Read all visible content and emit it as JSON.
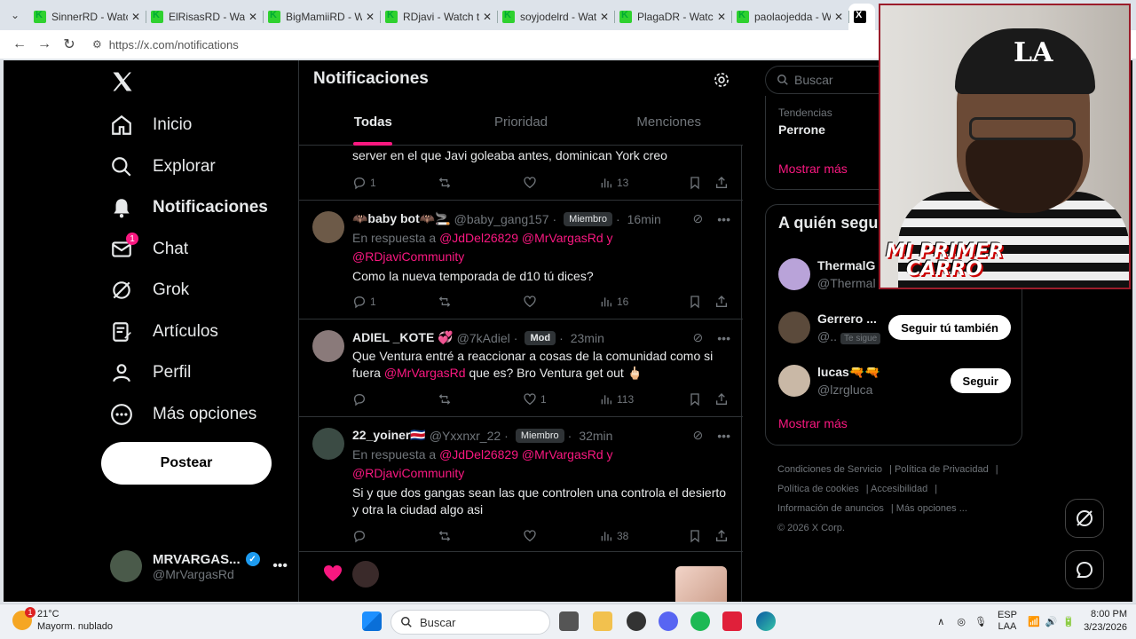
{
  "browser": {
    "tabs": [
      {
        "title": "SinnerRD - Watch t"
      },
      {
        "title": "ElRisasRD - Watch t"
      },
      {
        "title": "BigMamiiRD - Watc"
      },
      {
        "title": "RDjavi - Watch the"
      },
      {
        "title": "soyjodelrd - Watch"
      },
      {
        "title": "PlagaDR - Watch th"
      },
      {
        "title": "paolaojedda - Watc"
      }
    ],
    "url": "https://x.com/notifications"
  },
  "sidebar": {
    "items": [
      {
        "label": "Inicio"
      },
      {
        "label": "Explorar"
      },
      {
        "label": "Notificaciones"
      },
      {
        "label": "Chat",
        "badge": "1"
      },
      {
        "label": "Grok"
      },
      {
        "label": "Artículos"
      },
      {
        "label": "Perfil"
      },
      {
        "label": "Más opciones"
      }
    ],
    "post_label": "Postear",
    "profile": {
      "name": "MRVARGAS...",
      "handle": "@MrVargasRd"
    }
  },
  "main": {
    "title": "Notificaciones",
    "tabs": [
      {
        "label": "Todas"
      },
      {
        "label": "Prioridad"
      },
      {
        "label": "Menciones"
      }
    ],
    "posts": [
      {
        "body": "server en el que Javi goleaba antes, dominican York creo",
        "replies": "1",
        "likes": "",
        "views": "13"
      },
      {
        "name": "🦇baby bot🦇🚬",
        "handle": "@baby_gang157",
        "tag": "Miembro",
        "time": "16min",
        "reply_prefix": "En respuesta a ",
        "reply_mentions": "@JdDel26829 @MrVargasRd y @RDjaviCommunity",
        "body": "Como la nueva temporada de d10 tú dices?",
        "replies": "1",
        "likes": "",
        "views": "16"
      },
      {
        "name": "ADIEL _KOTE 💞",
        "handle": "@7kAdiel",
        "tag": "Mod",
        "time": "23min",
        "body_pre": "Que Ventura entré a reaccionar a cosas de la comunidad como si fuera ",
        "body_mention": "@MrVargasRd",
        "body_post": " que es? Bro Ventura get out 🖕🏻",
        "replies": "",
        "likes": "1",
        "views": "113"
      },
      {
        "name": "22_yoiner🇨🇷",
        "handle": "@Yxxnxr_22",
        "tag": "Miembro",
        "time": "32min",
        "reply_prefix": "En respuesta a ",
        "reply_mentions": "@JdDel26829 @MrVargasRd y @RDjaviCommunity",
        "body": "Si y que dos gangas sean las que controlen una controla el desierto y otra la ciudad algo asi",
        "replies": "",
        "likes": "",
        "views": "38"
      }
    ]
  },
  "right": {
    "search_placeholder": "Buscar",
    "trends": {
      "subtitle": "Tendencias",
      "title": "Perrone",
      "more": "Mostrar más"
    },
    "who": {
      "title": "A quién segu",
      "rows": [
        {
          "name": "ThermalG",
          "handle": "@Thermal",
          "button": ""
        },
        {
          "name": "Gerrero ...",
          "handle": "@..",
          "follows_you": "Te sigue",
          "button": "Seguir tú también"
        },
        {
          "name": "lucas🔫🔫",
          "handle": "@lzrgluca",
          "button": "Seguir"
        }
      ],
      "more": "Mostrar más"
    },
    "footer": [
      "Condiciones de Servicio",
      "Política de Privacidad",
      "Política de cookies",
      "Accesibilidad",
      "Información de anuncios",
      "Más opciones ...",
      "© 2026 X Corp."
    ]
  },
  "webcam": {
    "overlay_text_1": "MI PRIMER",
    "overlay_text_2": "CARRO"
  },
  "taskbar": {
    "weather_temp": "21°C",
    "weather_desc": "Mayorm. nublado",
    "weather_badge": "1",
    "search": "Buscar",
    "lang_1": "ESP",
    "lang_2": "LAA",
    "time": "8:00 PM",
    "date": "3/23/2026"
  },
  "colors": {
    "accent": "#f91880",
    "background": "#000000",
    "muted": "#71767b"
  }
}
